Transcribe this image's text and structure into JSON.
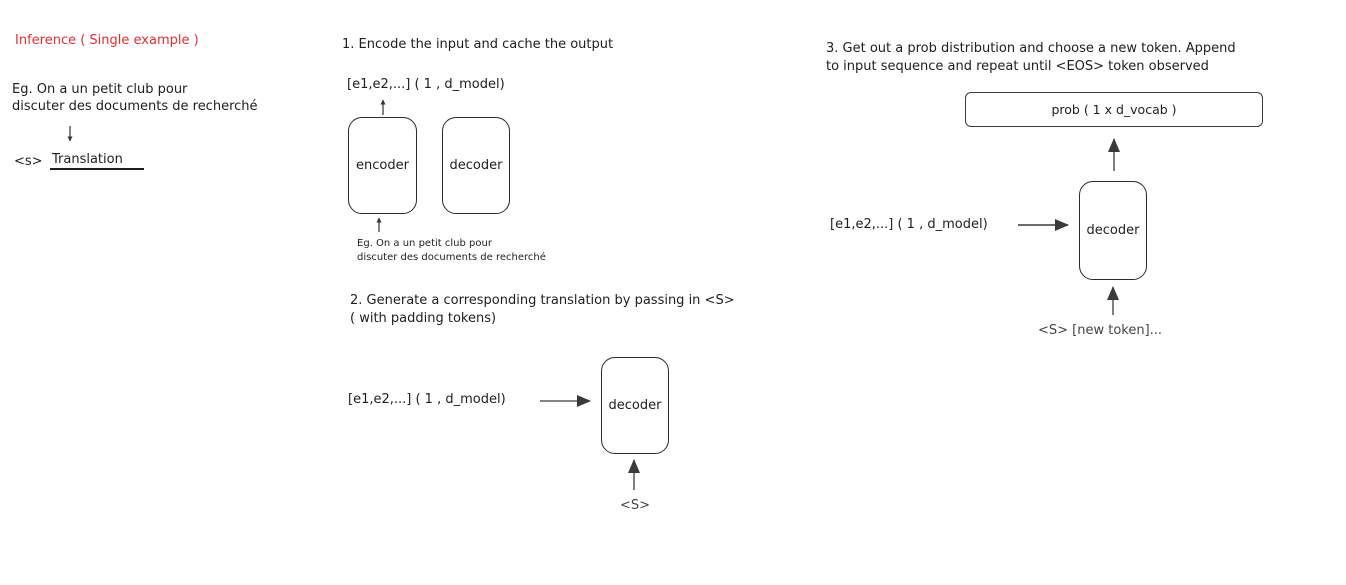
{
  "left_panel": {
    "title": "Inference ( Single example )",
    "example_line1": "Eg. On a un petit club pour",
    "example_line2": "discuter des documents de recherché",
    "output_prefix": "<s>",
    "output_label": "Translation"
  },
  "step1": {
    "heading": "1. Encode the input and cache the output",
    "output_label": "[e1,e2,...] ( 1 , d_model)",
    "encoder_label": "encoder",
    "decoder_label": "decoder",
    "input_line1": "Eg. On a un petit club pour",
    "input_line2": "discuter des documents de recherché"
  },
  "step2": {
    "heading_line1": "2. Generate a corresponding translation by passing in <S>",
    "heading_line2": "( with padding tokens)",
    "memory_label": "[e1,e2,...] ( 1 , d_model)",
    "decoder_label": "decoder",
    "input_label": "<S>"
  },
  "step3": {
    "heading_line1": "3. Get out a prob distribution and choose a new token. Append",
    "heading_line2": "to input sequence and repeat until <EOS> token observed",
    "prob_label": "prob ( 1 x d_vocab )",
    "memory_label": "[e1,e2,...] ( 1 , d_model)",
    "decoder_label": "decoder",
    "input_label": "<S> [new token]..."
  },
  "colors": {
    "accent_red": "#e03131",
    "stroke": "#1e1e1e"
  }
}
